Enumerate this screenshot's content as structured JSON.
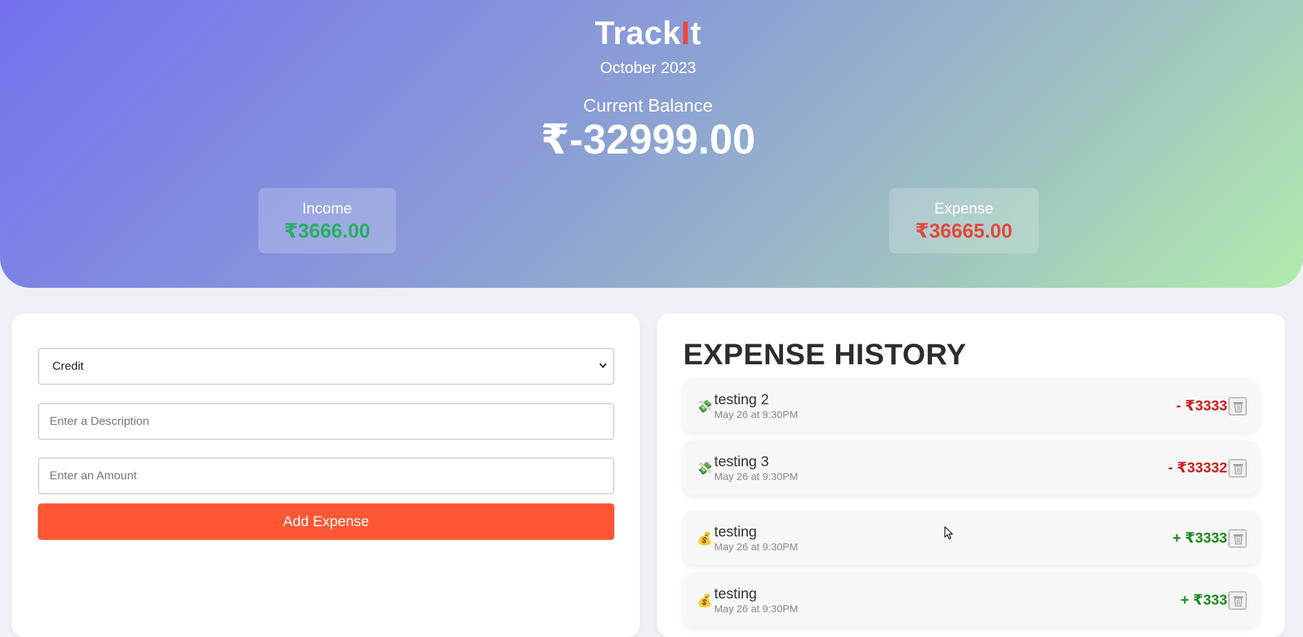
{
  "header": {
    "brand_prefix": "Track",
    "brand_highlight": "I",
    "brand_suffix": "t",
    "month": "October 2023",
    "balance_label": "Current Balance",
    "balance_value": "₹-32999.00",
    "income_label": "Income",
    "income_value": "₹3666.00",
    "expense_label": "Expense",
    "expense_value": "₹36665.00"
  },
  "form": {
    "type_selected": "Credit",
    "description_placeholder": "Enter a Description",
    "amount_placeholder": "Enter an Amount",
    "submit_label": "Add Expense"
  },
  "history": {
    "title": "EXPENSE HISTORY",
    "items": [
      {
        "icon": "💸",
        "title": "testing 2",
        "time": "May 26 at 9:30PM",
        "amount": "- ₹3333"
      },
      {
        "icon": "💸",
        "title": "testing 3",
        "time": "May 26 at 9:30PM",
        "amount": "- ₹33332"
      },
      {
        "icon": "💰",
        "title": "testing",
        "time": "May 26 at 9:30PM",
        "amount": "+ ₹3333"
      },
      {
        "icon": "💰",
        "title": "testing",
        "time": "May 26 at 9:30PM",
        "amount": "+ ₹333"
      }
    ]
  },
  "colors": {
    "accent": "#ff5733",
    "income": "#27ae60",
    "expense": "#e5483c",
    "debit_amount": "#cc1f1f",
    "credit_amount": "#1d8a1d"
  }
}
